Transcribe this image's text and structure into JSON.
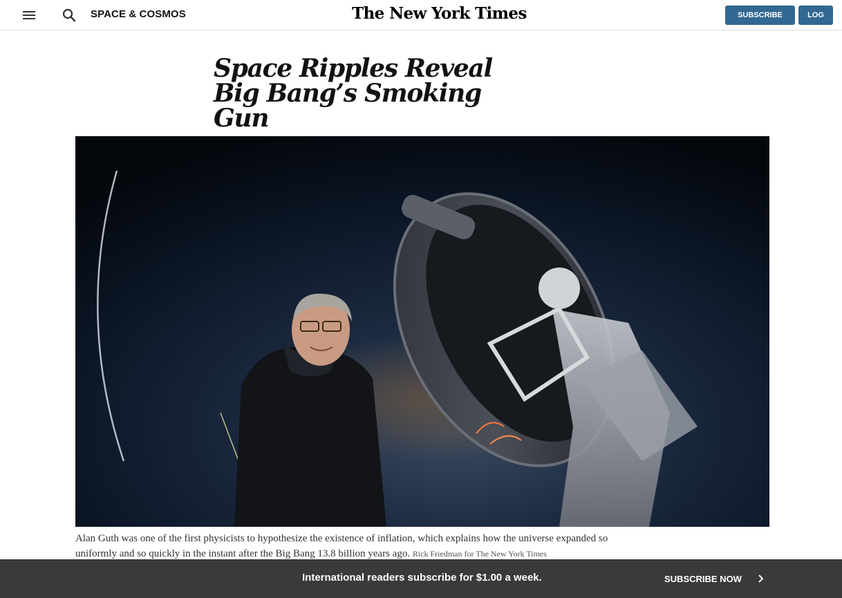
{
  "header": {
    "menu_icon": "hamburger-menu-icon",
    "search_icon": "search-icon",
    "section": "SPACE & COSMOS",
    "logo": "The New York Times",
    "subscribe_label": "SUBSCRIBE NOW",
    "login_label": "LOG IN",
    "accent_color": "#326891"
  },
  "article": {
    "headline_line1": "Space Ripples Reveal",
    "headline_line2": "Big Bang’s Smoking Gun",
    "caption": "Alan Guth was one of the first physicists to hypothesize the existence of inflation, which explains how the universe expanded so uniformly and so quickly in the instant after the Big Bang 13.8 billion years ago.",
    "credit": "Rick Friedman for The New York Times"
  },
  "dock": {
    "message": "International readers subscribe for $1.00 a week.",
    "cta_label": "SUBSCRIBE NOW",
    "cta_icon": "chevron-right-icon",
    "background_color": "#3a3a3a"
  }
}
